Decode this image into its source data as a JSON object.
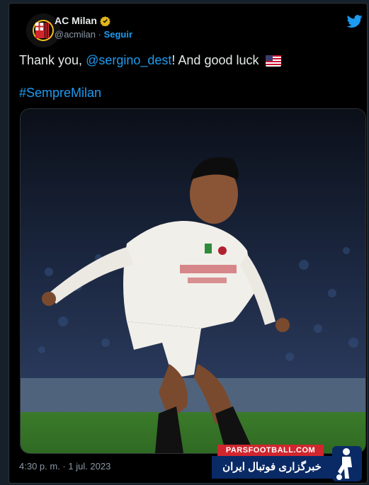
{
  "tweet": {
    "display_name": "AC Milan",
    "handle": "@acmilan",
    "separator": "·",
    "follow_label": "Seguir",
    "text_prefix": "Thank you, ",
    "mention": "@sergino_dest",
    "text_suffix": "! And good luck",
    "flag_icon": "us-flag-icon",
    "hashtag": "#SempreMilan",
    "timestamp": "4:30 p. m. · 1 jul. 2023",
    "media_icon": "football-player-photo"
  },
  "watermark": {
    "site": "PARSFOOTBALL.COM",
    "tagline": "خبرگزاری فوتبال ایران"
  },
  "colors": {
    "background": "#000000",
    "text": "#e7e9ea",
    "secondary": "#8b98a5",
    "accent": "#1d9bf0",
    "milan_red": "#d1262e"
  }
}
